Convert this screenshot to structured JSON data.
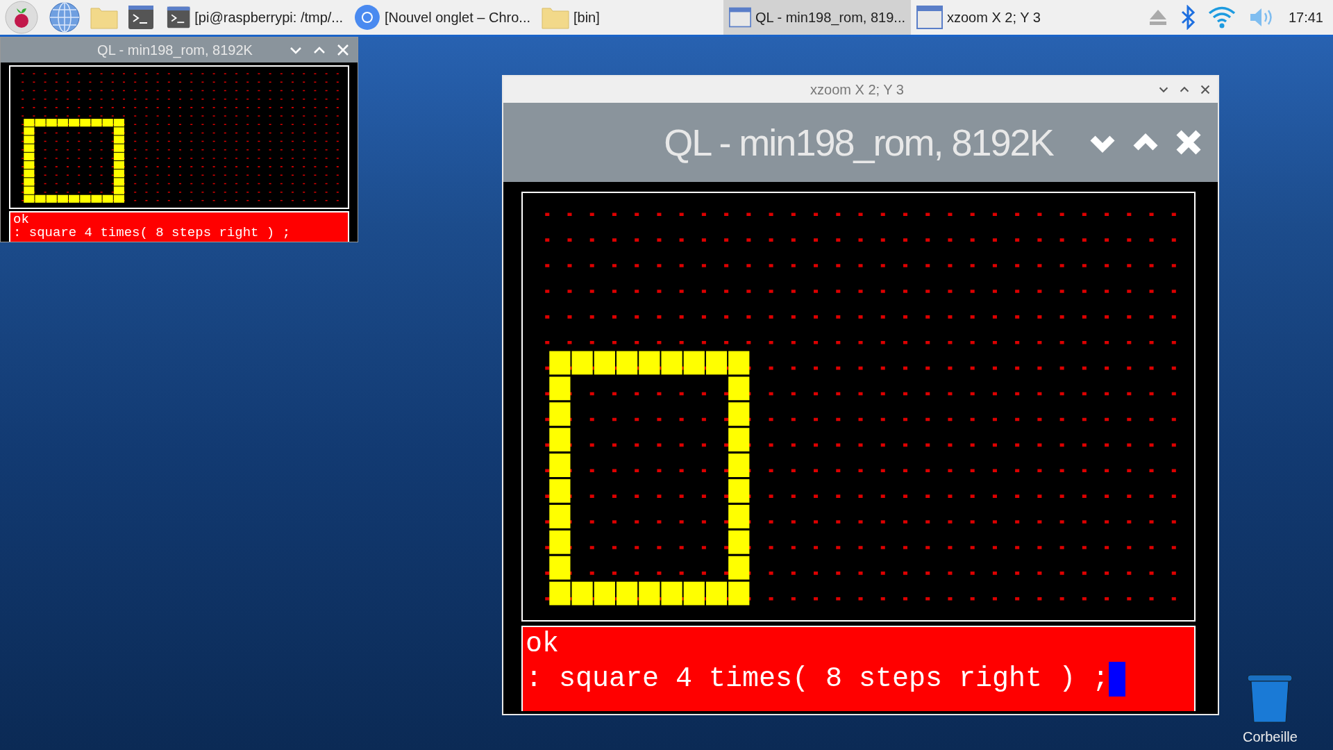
{
  "taskbar": {
    "tasks": [
      {
        "kind": "terminal",
        "label": "[pi@raspberrypi: /tmp/...",
        "selected": false
      },
      {
        "kind": "browser",
        "label": "[Nouvel onglet – Chro...",
        "selected": false
      },
      {
        "kind": "folder",
        "label": "[bin]",
        "selected": false
      },
      {
        "kind": "window",
        "label": "QL - min198_rom, 819...",
        "selected": true
      },
      {
        "kind": "window",
        "label": "xzoom X 2; Y 3",
        "selected": false
      }
    ],
    "clock": "17:41"
  },
  "ql_window": {
    "title": "QL - min198_rom, 8192K",
    "console": [
      "ok",
      ": square 4 times( 8 steps right ) ;"
    ]
  },
  "zoom_window": {
    "title": "xzoom X 2; Y 3",
    "zoomed_title": "QL - min198_rom, 8192K",
    "console": [
      "ok",
      ": square 4 times( 8 steps right ) ;"
    ]
  },
  "desktop_icons": [
    {
      "label": "Corbeille"
    }
  ]
}
